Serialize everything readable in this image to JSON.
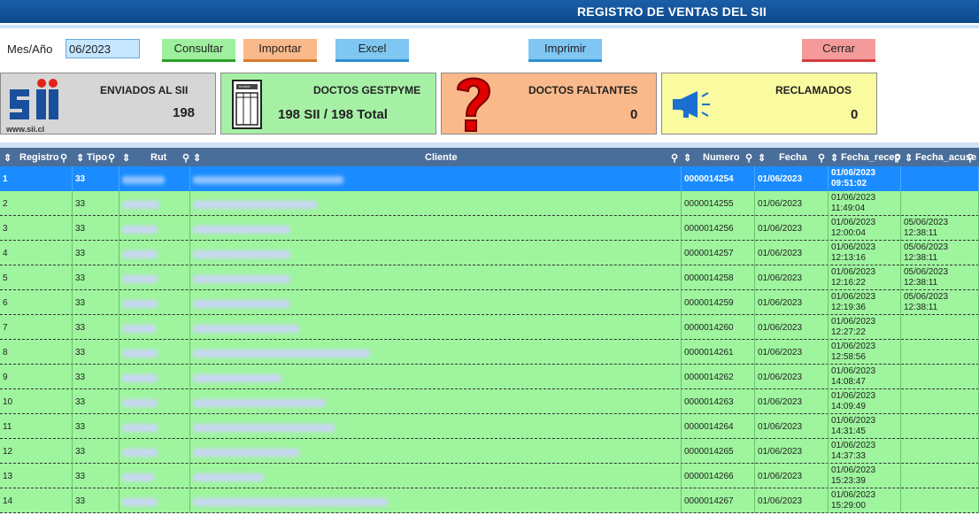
{
  "title": "REGISTRO DE VENTAS DEL SII",
  "toolbar": {
    "mes_label": "Mes/Año",
    "mes_value": "06/2023",
    "consultar": "Consultar",
    "importar": "Importar",
    "excel": "Excel",
    "imprimir": "Imprimir",
    "cerrar": "Cerrar"
  },
  "cards": {
    "enviados": {
      "title": "ENVIADOS AL SII",
      "value": "198",
      "logo_text": "www.sii.cl"
    },
    "gestpyme": {
      "title": "DOCTOS GESTPYME",
      "value": "198 SII / 198 Total",
      "icon_label": "Invoice"
    },
    "faltantes": {
      "title": "DOCTOS FALTANTES",
      "value": "0"
    },
    "reclamados": {
      "title": "RECLAMADOS",
      "value": "0"
    }
  },
  "columns": [
    "Registro",
    "Tipo",
    "Rut",
    "Cliente",
    "Numero",
    "Fecha",
    "Fecha_recep",
    "Fecha_acuse"
  ],
  "rows": [
    {
      "reg": "1",
      "tipo": "33",
      "num": "0000014254",
      "fecha": "01/06/2023",
      "rec1": "01/06/2023",
      "rec2": "09:51:02",
      "acu1": "",
      "acu2": ""
    },
    {
      "reg": "2",
      "tipo": "33",
      "num": "0000014255",
      "fecha": "01/06/2023",
      "rec1": "01/06/2023",
      "rec2": "11:49:04",
      "acu1": "",
      "acu2": ""
    },
    {
      "reg": "3",
      "tipo": "33",
      "num": "0000014256",
      "fecha": "01/06/2023",
      "rec1": "01/06/2023",
      "rec2": "12:00:04",
      "acu1": "05/06/2023",
      "acu2": "12:38:11"
    },
    {
      "reg": "4",
      "tipo": "33",
      "num": "0000014257",
      "fecha": "01/06/2023",
      "rec1": "01/06/2023",
      "rec2": "12:13:16",
      "acu1": "05/06/2023",
      "acu2": "12:38:11"
    },
    {
      "reg": "5",
      "tipo": "33",
      "num": "0000014258",
      "fecha": "01/06/2023",
      "rec1": "01/06/2023",
      "rec2": "12:16:22",
      "acu1": "05/06/2023",
      "acu2": "12:38:11"
    },
    {
      "reg": "6",
      "tipo": "33",
      "num": "0000014259",
      "fecha": "01/06/2023",
      "rec1": "01/06/2023",
      "rec2": "12:19:36",
      "acu1": "05/06/2023",
      "acu2": "12:38:11"
    },
    {
      "reg": "7",
      "tipo": "33",
      "num": "0000014260",
      "fecha": "01/06/2023",
      "rec1": "01/06/2023",
      "rec2": "12:27:22",
      "acu1": "",
      "acu2": ""
    },
    {
      "reg": "8",
      "tipo": "33",
      "num": "0000014261",
      "fecha": "01/06/2023",
      "rec1": "01/06/2023",
      "rec2": "12:58:56",
      "acu1": "",
      "acu2": ""
    },
    {
      "reg": "9",
      "tipo": "33",
      "num": "0000014262",
      "fecha": "01/06/2023",
      "rec1": "01/06/2023",
      "rec2": "14:08:47",
      "acu1": "",
      "acu2": ""
    },
    {
      "reg": "10",
      "tipo": "33",
      "num": "0000014263",
      "fecha": "01/06/2023",
      "rec1": "01/06/2023",
      "rec2": "14:09:49",
      "acu1": "",
      "acu2": ""
    },
    {
      "reg": "11",
      "tipo": "33",
      "num": "0000014264",
      "fecha": "01/06/2023",
      "rec1": "01/06/2023",
      "rec2": "14:31:45",
      "acu1": "",
      "acu2": ""
    },
    {
      "reg": "12",
      "tipo": "33",
      "num": "0000014265",
      "fecha": "01/06/2023",
      "rec1": "01/06/2023",
      "rec2": "14:37:33",
      "acu1": "",
      "acu2": ""
    },
    {
      "reg": "13",
      "tipo": "33",
      "num": "0000014266",
      "fecha": "01/06/2023",
      "rec1": "01/06/2023",
      "rec2": "15:23:39",
      "acu1": "",
      "acu2": ""
    },
    {
      "reg": "14",
      "tipo": "33",
      "num": "0000014267",
      "fecha": "01/06/2023",
      "rec1": "01/06/2023",
      "rec2": "15:29:00",
      "acu1": "",
      "acu2": ""
    }
  ]
}
